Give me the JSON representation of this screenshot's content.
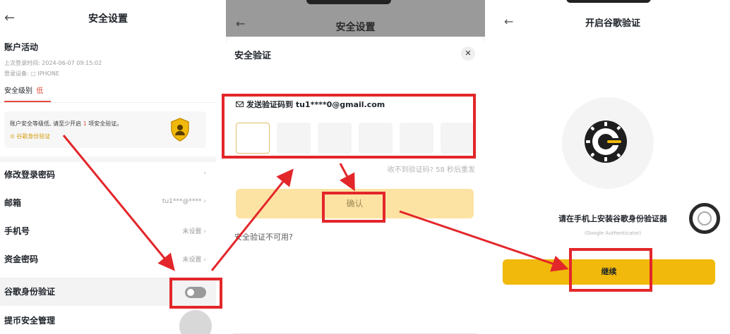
{
  "panel1": {
    "title": "安全设置",
    "account_activity": "账户活动",
    "last_login": "上次登录时间: 2024-06-07 09:15:02",
    "login_device": "登录设备: ▢ IPHONE",
    "security_level_label": "安全级别",
    "security_level_value": "低",
    "warning_prefix": "账户安全等级低, 请至少开启",
    "warning_count": "1",
    "warning_suffix": "项安全验证。",
    "google_auth_link": "⊙ 谷歌身份验证",
    "rows": [
      {
        "label": "修改登录密码",
        "value": ""
      },
      {
        "label": "邮箱",
        "value": "tu1***@****"
      },
      {
        "label": "手机号",
        "value": "未设置"
      },
      {
        "label": "资金密码",
        "value": "未设置"
      },
      {
        "label": "谷歌身份验证",
        "value": ""
      },
      {
        "label": "提币安全管理",
        "value": ""
      }
    ],
    "chevron": "›"
  },
  "panel2": {
    "header_title": "安全设置",
    "sheet_title": "安全验证",
    "close": "✕",
    "send_code_text": "发送验证码到 tu1****0@gmail.com",
    "resend_text": "收不到验证码? 58 秒后重发",
    "confirm_label": "确认",
    "unavailable_text": "安全验证不可用?"
  },
  "panel3": {
    "title": "开启谷歌验证",
    "install_text": "请在手机上安装谷歌身份验证器",
    "sub_text": "(Google Authenticator)",
    "continue_label": "继续"
  },
  "icons": {
    "back": "←",
    "shield": "shield-icon",
    "mail": "mail-icon",
    "google_authenticator": "google-authenticator-icon"
  },
  "colors": {
    "accent": "#f0b90b",
    "danger": "#e04b3f",
    "annotation_red": "#e3262a"
  }
}
